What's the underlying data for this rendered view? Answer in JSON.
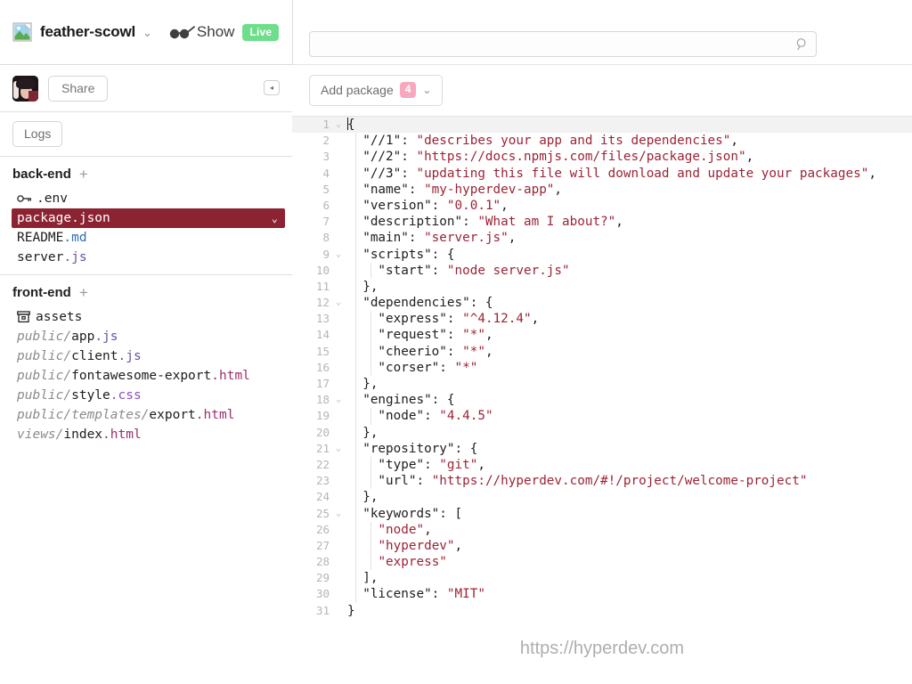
{
  "header": {
    "project_name": "feather-scowl",
    "project_caret": "⌄",
    "logo_icon": "broken-image-icon",
    "glasses_icon": "glasses-icon",
    "show_label": "Show",
    "live_badge": "Live"
  },
  "search": {
    "value": "",
    "placeholder": "",
    "icon": "search-icon"
  },
  "share_row": {
    "avatar": "user-avatar",
    "share_label": "Share",
    "collapse_icon": "◂"
  },
  "logs_row": {
    "logs_label": "Logs"
  },
  "tree": {
    "groups": [
      {
        "title": "back-end",
        "add_label": "+",
        "files": [
          {
            "icon": "key-icon",
            "dir": "",
            "base": ".env",
            "ext": "",
            "ext_class": "",
            "selected": false
          },
          {
            "icon": "",
            "dir": "",
            "base": "package",
            "ext": ".json",
            "ext_class": "",
            "selected": true,
            "chevron": "⌄"
          },
          {
            "icon": "",
            "dir": "",
            "base": "README",
            "ext": ".md",
            "ext_class": "ext-md",
            "selected": false
          },
          {
            "icon": "",
            "dir": "",
            "base": "server",
            "ext": ".js",
            "ext_class": "ext-js",
            "selected": false
          }
        ]
      },
      {
        "title": "front-end",
        "add_label": "+",
        "files": [
          {
            "icon": "box-icon",
            "dir": "",
            "base": "assets",
            "ext": "",
            "ext_class": "",
            "selected": false
          },
          {
            "icon": "",
            "dir": "public/",
            "base": "app",
            "ext": ".js",
            "ext_class": "ext-js",
            "selected": false
          },
          {
            "icon": "",
            "dir": "public/",
            "base": "client",
            "ext": ".js",
            "ext_class": "ext-js",
            "selected": false
          },
          {
            "icon": "",
            "dir": "public/",
            "base": "fontawesome-export",
            "ext": ".html",
            "ext_class": "ext-html",
            "selected": false
          },
          {
            "icon": "",
            "dir": "public/",
            "base": "style",
            "ext": ".css",
            "ext_class": "ext-css",
            "selected": false
          },
          {
            "icon": "",
            "dir": "public/templates/",
            "base": "export",
            "ext": ".html",
            "ext_class": "ext-html",
            "selected": false
          },
          {
            "icon": "",
            "dir": "views/",
            "base": "index",
            "ext": ".html",
            "ext_class": "ext-html",
            "selected": false
          }
        ]
      }
    ]
  },
  "editor_toolbar": {
    "add_package_label": "Add package",
    "package_count": "4",
    "caret": "⌄"
  },
  "editor": {
    "file": "package.json",
    "lines": [
      {
        "n": "1",
        "fold": "⌄",
        "active": true,
        "indent": 0,
        "parts": [
          {
            "t": "{",
            "c": ""
          }
        ],
        "cursor_before": true
      },
      {
        "n": "2",
        "fold": "",
        "active": false,
        "indent": 1,
        "parts": [
          {
            "t": "  \"//1\": ",
            "c": ""
          },
          {
            "t": "\"describes your app and its dependencies\"",
            "c": "str"
          },
          {
            "t": ",",
            "c": ""
          }
        ]
      },
      {
        "n": "3",
        "fold": "",
        "active": false,
        "indent": 1,
        "parts": [
          {
            "t": "  \"//2\": ",
            "c": ""
          },
          {
            "t": "\"https://docs.npmjs.com/files/package.json\"",
            "c": "str"
          },
          {
            "t": ",",
            "c": ""
          }
        ]
      },
      {
        "n": "4",
        "fold": "",
        "active": false,
        "indent": 1,
        "parts": [
          {
            "t": "  \"//3\": ",
            "c": ""
          },
          {
            "t": "\"updating this file will download and update your packages\"",
            "c": "str"
          },
          {
            "t": ",",
            "c": ""
          }
        ]
      },
      {
        "n": "5",
        "fold": "",
        "active": false,
        "indent": 1,
        "parts": [
          {
            "t": "  \"name\": ",
            "c": ""
          },
          {
            "t": "\"my-hyperdev-app\"",
            "c": "str"
          },
          {
            "t": ",",
            "c": ""
          }
        ]
      },
      {
        "n": "6",
        "fold": "",
        "active": false,
        "indent": 1,
        "parts": [
          {
            "t": "  \"version\": ",
            "c": ""
          },
          {
            "t": "\"0.0.1\"",
            "c": "str"
          },
          {
            "t": ",",
            "c": ""
          }
        ]
      },
      {
        "n": "7",
        "fold": "",
        "active": false,
        "indent": 1,
        "parts": [
          {
            "t": "  \"description\": ",
            "c": ""
          },
          {
            "t": "\"What am I about?\"",
            "c": "str"
          },
          {
            "t": ",",
            "c": ""
          }
        ]
      },
      {
        "n": "8",
        "fold": "",
        "active": false,
        "indent": 1,
        "parts": [
          {
            "t": "  \"main\": ",
            "c": ""
          },
          {
            "t": "\"server.js\"",
            "c": "str"
          },
          {
            "t": ",",
            "c": ""
          }
        ]
      },
      {
        "n": "9",
        "fold": "⌄",
        "active": false,
        "indent": 1,
        "parts": [
          {
            "t": "  \"scripts\": {",
            "c": ""
          }
        ]
      },
      {
        "n": "10",
        "fold": "",
        "active": false,
        "indent": 2,
        "parts": [
          {
            "t": "    \"start\": ",
            "c": ""
          },
          {
            "t": "\"node server.js\"",
            "c": "str"
          }
        ]
      },
      {
        "n": "11",
        "fold": "",
        "active": false,
        "indent": 1,
        "parts": [
          {
            "t": "  },",
            "c": ""
          }
        ]
      },
      {
        "n": "12",
        "fold": "⌄",
        "active": false,
        "indent": 1,
        "parts": [
          {
            "t": "  \"dependencies\": {",
            "c": ""
          }
        ]
      },
      {
        "n": "13",
        "fold": "",
        "active": false,
        "indent": 2,
        "parts": [
          {
            "t": "    \"express\": ",
            "c": ""
          },
          {
            "t": "\"^4.12.4\"",
            "c": "str"
          },
          {
            "t": ",",
            "c": ""
          }
        ]
      },
      {
        "n": "14",
        "fold": "",
        "active": false,
        "indent": 2,
        "parts": [
          {
            "t": "    \"request\": ",
            "c": ""
          },
          {
            "t": "\"*\"",
            "c": "str"
          },
          {
            "t": ",",
            "c": ""
          }
        ]
      },
      {
        "n": "15",
        "fold": "",
        "active": false,
        "indent": 2,
        "parts": [
          {
            "t": "    \"cheerio\": ",
            "c": ""
          },
          {
            "t": "\"*\"",
            "c": "str"
          },
          {
            "t": ",",
            "c": ""
          }
        ]
      },
      {
        "n": "16",
        "fold": "",
        "active": false,
        "indent": 2,
        "parts": [
          {
            "t": "    \"corser\": ",
            "c": ""
          },
          {
            "t": "\"*\"",
            "c": "str"
          }
        ]
      },
      {
        "n": "17",
        "fold": "",
        "active": false,
        "indent": 1,
        "parts": [
          {
            "t": "  },",
            "c": ""
          }
        ]
      },
      {
        "n": "18",
        "fold": "⌄",
        "active": false,
        "indent": 1,
        "parts": [
          {
            "t": "  \"engines\": {",
            "c": ""
          }
        ]
      },
      {
        "n": "19",
        "fold": "",
        "active": false,
        "indent": 2,
        "parts": [
          {
            "t": "    \"node\": ",
            "c": ""
          },
          {
            "t": "\"4.4.5\"",
            "c": "str"
          }
        ]
      },
      {
        "n": "20",
        "fold": "",
        "active": false,
        "indent": 1,
        "parts": [
          {
            "t": "  },",
            "c": ""
          }
        ]
      },
      {
        "n": "21",
        "fold": "⌄",
        "active": false,
        "indent": 1,
        "parts": [
          {
            "t": "  \"repository\": {",
            "c": ""
          }
        ]
      },
      {
        "n": "22",
        "fold": "",
        "active": false,
        "indent": 2,
        "parts": [
          {
            "t": "    \"type\": ",
            "c": ""
          },
          {
            "t": "\"git\"",
            "c": "str"
          },
          {
            "t": ",",
            "c": ""
          }
        ]
      },
      {
        "n": "23",
        "fold": "",
        "active": false,
        "indent": 2,
        "parts": [
          {
            "t": "    \"url\": ",
            "c": ""
          },
          {
            "t": "\"https://hyperdev.com/#!/project/welcome-project\"",
            "c": "str"
          }
        ]
      },
      {
        "n": "24",
        "fold": "",
        "active": false,
        "indent": 1,
        "parts": [
          {
            "t": "  },",
            "c": ""
          }
        ]
      },
      {
        "n": "25",
        "fold": "⌄",
        "active": false,
        "indent": 1,
        "parts": [
          {
            "t": "  \"keywords\": [",
            "c": ""
          }
        ]
      },
      {
        "n": "26",
        "fold": "",
        "active": false,
        "indent": 2,
        "parts": [
          {
            "t": "    ",
            "c": ""
          },
          {
            "t": "\"node\"",
            "c": "str"
          },
          {
            "t": ",",
            "c": ""
          }
        ]
      },
      {
        "n": "27",
        "fold": "",
        "active": false,
        "indent": 2,
        "parts": [
          {
            "t": "    ",
            "c": ""
          },
          {
            "t": "\"hyperdev\"",
            "c": "str"
          },
          {
            "t": ",",
            "c": ""
          }
        ]
      },
      {
        "n": "28",
        "fold": "",
        "active": false,
        "indent": 2,
        "parts": [
          {
            "t": "    ",
            "c": ""
          },
          {
            "t": "\"express\"",
            "c": "str"
          }
        ]
      },
      {
        "n": "29",
        "fold": "",
        "active": false,
        "indent": 1,
        "parts": [
          {
            "t": "  ],",
            "c": ""
          }
        ]
      },
      {
        "n": "30",
        "fold": "",
        "active": false,
        "indent": 1,
        "parts": [
          {
            "t": "  \"license\": ",
            "c": ""
          },
          {
            "t": "\"MIT\"",
            "c": "str"
          }
        ]
      },
      {
        "n": "31",
        "fold": "",
        "active": false,
        "indent": 0,
        "parts": [
          {
            "t": "}",
            "c": ""
          }
        ]
      }
    ]
  },
  "footer": {
    "url": "https://hyperdev.com"
  },
  "colors": {
    "selected_file_bg": "#8b2332",
    "live_badge": "#6ede8a",
    "package_badge": "#f7a8bc",
    "string_literal": "#9b2335",
    "ext_js": "#6a4fa3",
    "ext_md": "#2f6fb5",
    "ext_html": "#9c2f6e",
    "ext_css": "#8a4fb8"
  }
}
